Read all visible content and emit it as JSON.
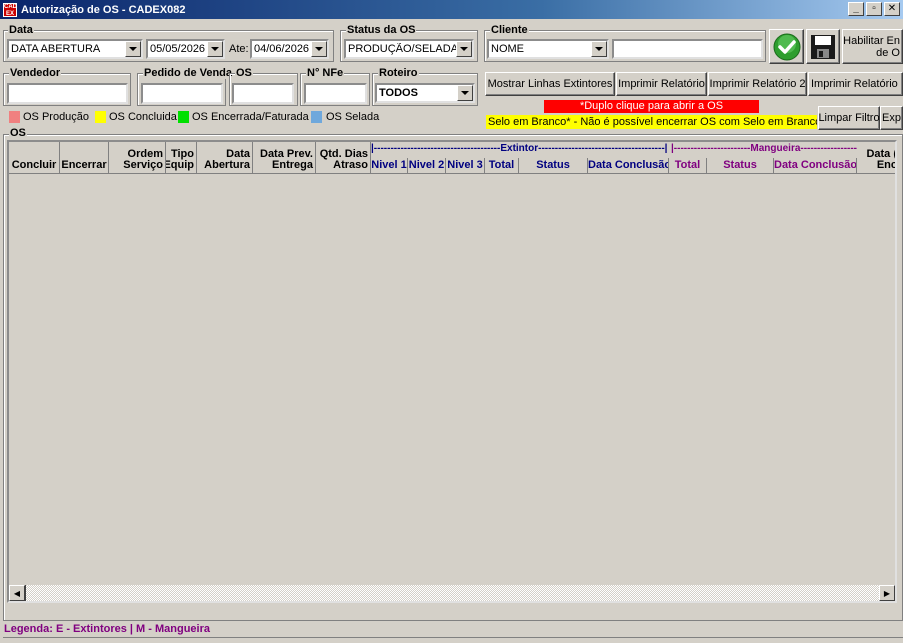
{
  "window": {
    "title": "Autorização de OS - CADEX082",
    "icon_text": "CAD EX"
  },
  "data_group": {
    "legend": "Data",
    "field": "DATA ABERTURA",
    "from": "05/05/2026",
    "to_label": "Ate:",
    "to": "04/06/2026"
  },
  "status_group": {
    "legend": "Status da OS",
    "value": "PRODUÇÃO/SELADA"
  },
  "cliente_group": {
    "legend": "Cliente",
    "field": "NOME",
    "value": ""
  },
  "toolbar": {
    "habilitar_label": "Habilitar En de O"
  },
  "filters": {
    "vendedor": "Vendedor",
    "pedido": "Pedido de Venda",
    "os": "OS",
    "nfe": "N° NFe",
    "roteiro": "Roteiro",
    "roteiro_value": "TODOS"
  },
  "buttons": {
    "mostrar": "Mostrar Linhas Extintores",
    "imprimir1": "Imprimir Relatório",
    "imprimir2": "Imprimir Relatório 2",
    "imprimir3": "Imprimir Relatório",
    "limpar": "Limpar Filtro",
    "exp": "Exp"
  },
  "legend_items": [
    {
      "label": "OS Produção",
      "color": "#f08080"
    },
    {
      "label": "OS Concluida",
      "color": "#ffff00"
    },
    {
      "label": "OS Encerrada/Faturada",
      "color": "#00e000"
    },
    {
      "label": "OS Selada",
      "color": "#6fa8dc"
    }
  ],
  "notices": {
    "duplo": "*Duplo clique para abrir a OS",
    "selo": "Selo em Branco* - Não é possível encerrar OS com Selo em Branco"
  },
  "grid": {
    "legend": "OS",
    "columns": [
      {
        "l1": "",
        "l2": "Concluir"
      },
      {
        "l1": "",
        "l2": "Encerrar"
      },
      {
        "l1": "Ordem",
        "l2": "Serviço"
      },
      {
        "l1": "Tipo",
        "l2": "Equip"
      },
      {
        "l1": "Data",
        "l2": "Abertura"
      },
      {
        "l1": "Data Prev.",
        "l2": "Entrega"
      },
      {
        "l1": "Qtd. Dias",
        "l2": "Atraso"
      }
    ],
    "extintor_band": "|--------------------------------------Extintor--------------------------------------|",
    "extintor_cols": [
      "Nivel 1",
      "Nivel 2",
      "Nivel 3",
      "Total",
      "Status",
      "Data Conclusão"
    ],
    "mangueira_band": "|-----------------------Mangueira------------------|",
    "mangueira_cols": [
      "Total",
      "Status",
      "Data Conclusão"
    ],
    "last_col": {
      "l1": "Data (",
      "l2": "Enc"
    }
  },
  "footer": {
    "legenda": "Legenda: E - Extintores | M - Mangueira"
  },
  "colors": {
    "extintor": "#000080",
    "mangueira": "#800080",
    "footer": "#800080",
    "duplo_bg": "#ff0000",
    "selo_bg": "#ffff00"
  }
}
